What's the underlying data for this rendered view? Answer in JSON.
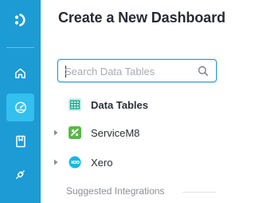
{
  "nav": {
    "items": [
      {
        "icon": "home-icon",
        "active": false
      },
      {
        "icon": "dashboard-gauge-icon",
        "active": true
      },
      {
        "icon": "bookmark-icon",
        "active": false
      },
      {
        "icon": "integrations-icon",
        "active": false
      }
    ]
  },
  "page": {
    "title": "Create a New Dashboard"
  },
  "search": {
    "placeholder": "Search Data Tables",
    "value": ""
  },
  "tree": {
    "items": [
      {
        "label": "Data Tables",
        "icon": "table-grid-icon",
        "expandable": false
      },
      {
        "label": "ServiceM8",
        "icon": "servicem8-icon",
        "expandable": true
      },
      {
        "label": "Xero",
        "icon": "xero-icon",
        "expandable": true
      }
    ]
  },
  "suggested": {
    "label": "Suggested Integrations"
  },
  "colors": {
    "rail": "#1d9bd5",
    "rail_active": "#33c0ef",
    "accent": "#2e9ae0",
    "servicem8": "#58b847",
    "xero": "#19b5e8",
    "table_icon_bg": "#c9f0ea",
    "table_icon_fg": "#1aa58d"
  }
}
